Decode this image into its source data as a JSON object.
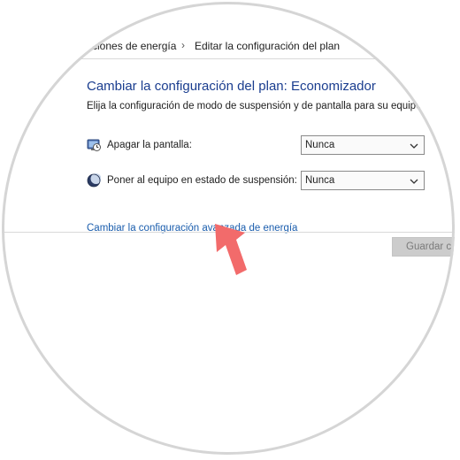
{
  "breadcrumb": {
    "parent": "ciones de energía",
    "separator": "›",
    "current": "Editar la configuración del plan"
  },
  "page": {
    "title": "Cambiar la configuración del plan: Economizador",
    "subtitle": "Elija la configuración de modo de suspensión y de pantalla para su equipo."
  },
  "settings": [
    {
      "label": "Apagar la pantalla:",
      "value": "Nunca",
      "icon": "display-clock-icon"
    },
    {
      "label": "Poner al equipo en estado de suspensión:",
      "value": "Nunca",
      "icon": "moon-sleep-icon"
    }
  ],
  "advanced_link": "Cambiar la configuración avanzada de energía",
  "footer": {
    "save_label": "Guardar c"
  },
  "colors": {
    "title": "#1a3d8f",
    "link": "#1a5dad",
    "arrow": "#f26b6b",
    "disabled_button": "#cccccc"
  }
}
